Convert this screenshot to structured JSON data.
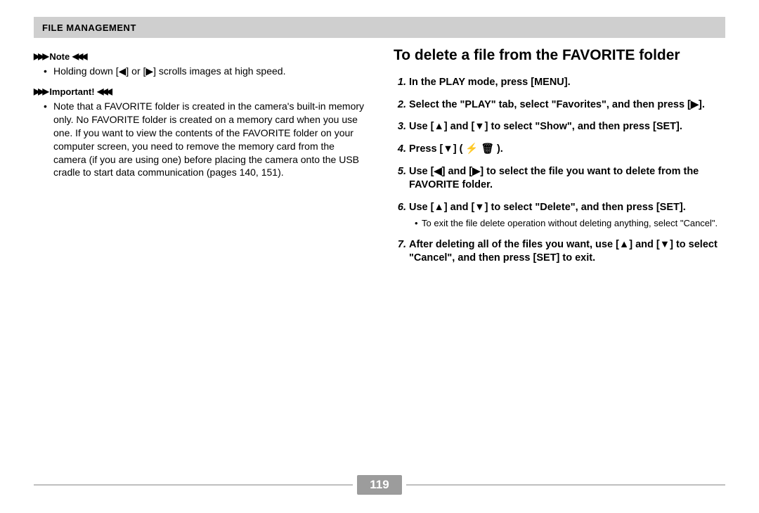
{
  "header": {
    "title": "File Management"
  },
  "left": {
    "note": {
      "label": "Note",
      "bullet": "Holding down [◀] or [▶] scrolls images at high speed."
    },
    "important": {
      "label": "Important!",
      "bullet": "Note that a FAVORITE folder is created in the camera's built-in memory only. No FAVORITE folder is created on a memory card when you use one. If you want to view the contents of the FAVORITE folder on your computer screen, you need to remove the memory card from the camera (if you are using one) before placing the camera onto the USB cradle to start data communication (pages 140, 151)."
    }
  },
  "right": {
    "title": "To delete a file from the FAVORITE folder",
    "steps": [
      {
        "text": "In the PLAY mode, press [MENU]."
      },
      {
        "text": "Select the \"PLAY\" tab, select \"Favorites\", and then press [▶]."
      },
      {
        "text": "Use [▲] and [▼] to select \"Show\", and then press [SET]."
      },
      {
        "text": "Press [▼] ( ⚡ 🗑 )."
      },
      {
        "text": "Use [◀] and [▶] to select the file you want to delete from the FAVORITE folder."
      },
      {
        "text": "Use [▲] and [▼] to select \"Delete\", and then press [SET].",
        "sub": "To exit the file delete operation without deleting anything, select \"Cancel\"."
      },
      {
        "text": "After deleting all of the files you want, use [▲] and [▼] to select \"Cancel\", and then press [SET] to exit."
      }
    ]
  },
  "page_number": "119"
}
